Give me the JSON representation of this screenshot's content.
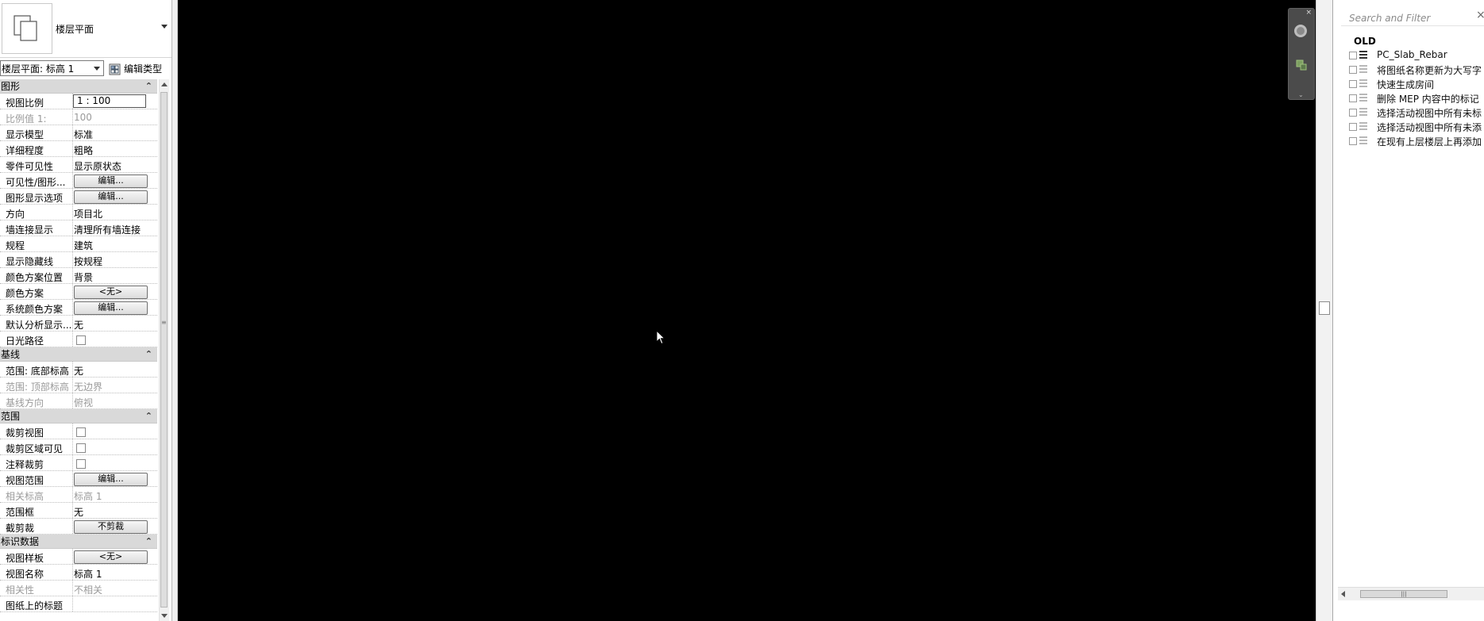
{
  "properties": {
    "type_name": "楼层平面",
    "instance_selector": "楼层平面: 标高 1",
    "edit_type_label": "编辑类型",
    "groups": [
      {
        "title": "图形",
        "collapse_icon": "double-chevron-up-icon",
        "rows": [
          {
            "name": "视图比例",
            "value": "1 : 100",
            "kind": "boxed"
          },
          {
            "name": "比例值 1:",
            "value": "100",
            "kind": "text",
            "dim": true
          },
          {
            "name": "显示模型",
            "value": "标准",
            "kind": "text"
          },
          {
            "name": "详细程度",
            "value": "粗略",
            "kind": "text"
          },
          {
            "name": "零件可见性",
            "value": "显示原状态",
            "kind": "text"
          },
          {
            "name": "可见性/图形...",
            "value": "编辑...",
            "kind": "button"
          },
          {
            "name": "图形显示选项",
            "value": "编辑...",
            "kind": "button"
          },
          {
            "name": "方向",
            "value": "项目北",
            "kind": "text"
          },
          {
            "name": "墙连接显示",
            "value": "清理所有墙连接",
            "kind": "text"
          },
          {
            "name": "规程",
            "value": "建筑",
            "kind": "text"
          },
          {
            "name": "显示隐藏线",
            "value": "按规程",
            "kind": "text"
          },
          {
            "name": "颜色方案位置",
            "value": "背景",
            "kind": "text"
          },
          {
            "name": "颜色方案",
            "value": "<无>",
            "kind": "button"
          },
          {
            "name": "系统颜色方案",
            "value": "编辑...",
            "kind": "button"
          },
          {
            "name": "默认分析显示...",
            "value": "无",
            "kind": "text"
          },
          {
            "name": "日光路径",
            "value": "",
            "kind": "checkbox"
          }
        ]
      },
      {
        "title": "基线",
        "collapse_icon": "double-chevron-up-icon",
        "rows": [
          {
            "name": "范围: 底部标高",
            "value": "无",
            "kind": "text"
          },
          {
            "name": "范围: 顶部标高",
            "value": "无边界",
            "kind": "text",
            "dim": true
          },
          {
            "name": "基线方向",
            "value": "俯视",
            "kind": "text",
            "dim": true
          }
        ]
      },
      {
        "title": "范围",
        "collapse_icon": "double-chevron-up-icon",
        "rows": [
          {
            "name": "裁剪视图",
            "value": "",
            "kind": "checkbox"
          },
          {
            "name": "裁剪区域可见",
            "value": "",
            "kind": "checkbox"
          },
          {
            "name": "注释裁剪",
            "value": "",
            "kind": "checkbox"
          },
          {
            "name": "视图范围",
            "value": "编辑...",
            "kind": "button"
          },
          {
            "name": "相关标高",
            "value": "标高 1",
            "kind": "text",
            "dim": true
          },
          {
            "name": "范围框",
            "value": "无",
            "kind": "text"
          },
          {
            "name": "截剪裁",
            "value": "不剪裁",
            "kind": "button"
          }
        ]
      },
      {
        "title": "标识数据",
        "collapse_icon": "double-chevron-up-icon",
        "rows": [
          {
            "name": "视图样板",
            "value": "<无>",
            "kind": "button"
          },
          {
            "name": "视图名称",
            "value": "标高 1",
            "kind": "text"
          },
          {
            "name": "相关性",
            "value": "不相关",
            "kind": "text",
            "dim": true
          },
          {
            "name": "图纸上的标题",
            "value": "",
            "kind": "text"
          }
        ]
      }
    ]
  },
  "canvas": {
    "background": "#000000",
    "nav_bar_close": "×"
  },
  "script_panel": {
    "search_placeholder": "Search and Filter",
    "close_glyph": "×",
    "group_title": "OLD",
    "items": [
      {
        "label": "PC_Slab_Rebar",
        "selected": true
      },
      {
        "label": "将图纸名称更新为大写字",
        "selected": false
      },
      {
        "label": "快速生成房间",
        "selected": false
      },
      {
        "label": "删除 MEP 内容中的标记",
        "selected": false
      },
      {
        "label": "选择活动视图中所有未标",
        "selected": false
      },
      {
        "label": "选择活动视图中所有未添",
        "selected": false
      },
      {
        "label": "在现有上层楼层上再添加",
        "selected": false
      }
    ]
  }
}
